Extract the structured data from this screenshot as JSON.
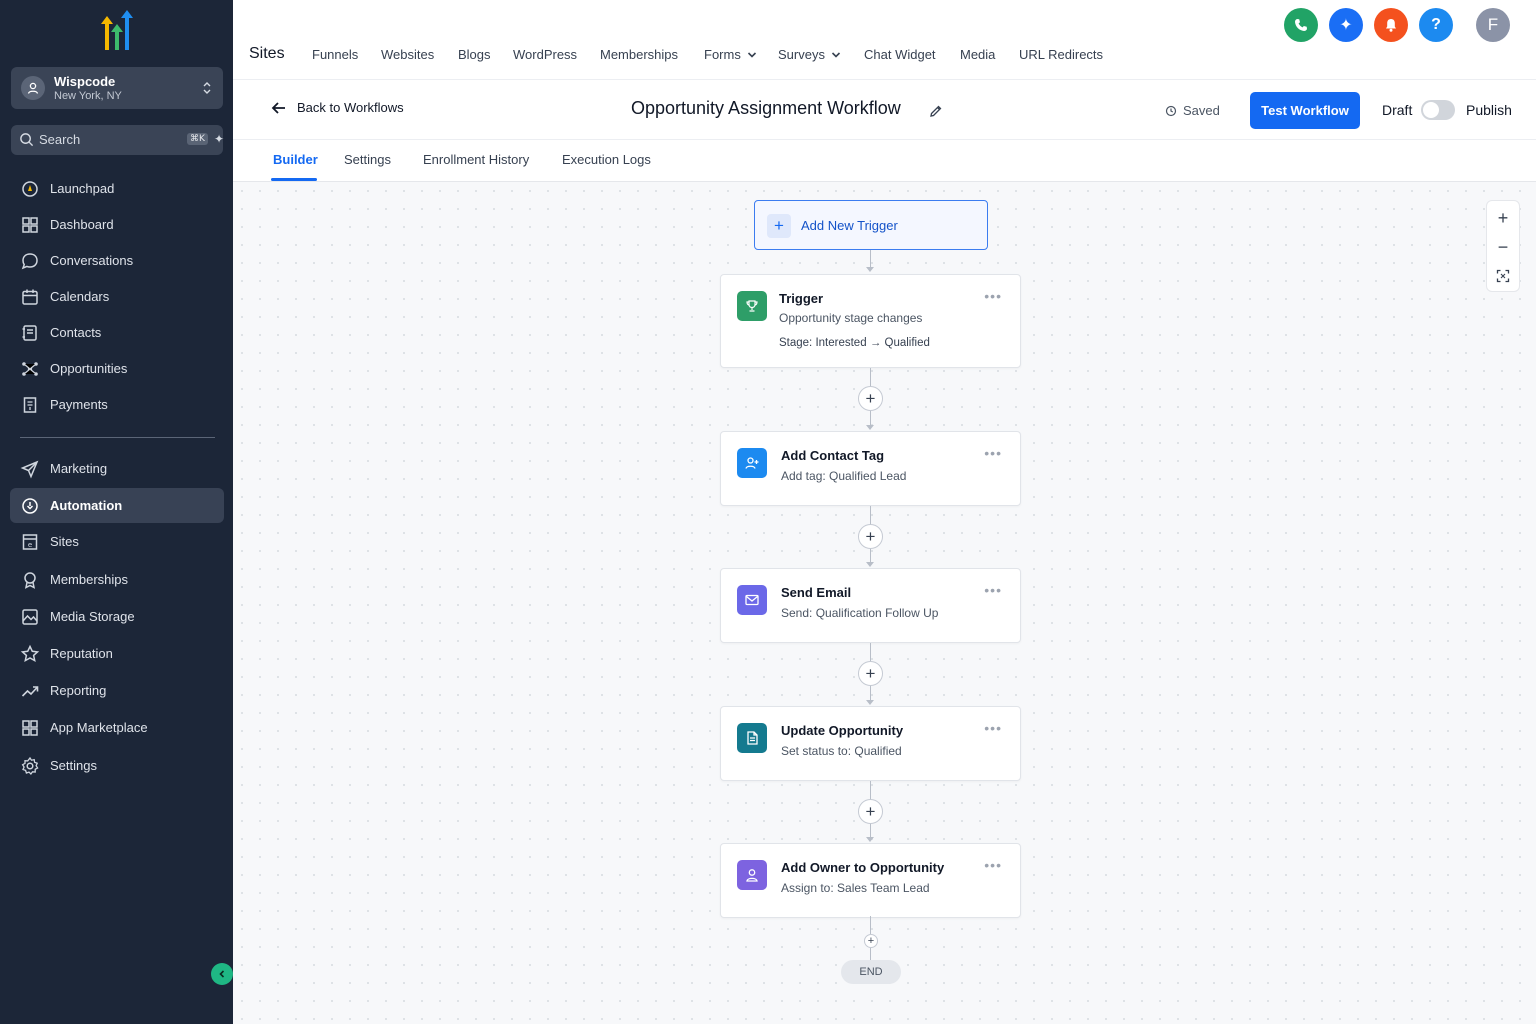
{
  "sidebar": {
    "account": {
      "name": "Wispcode",
      "location": "New York, NY"
    },
    "search": {
      "placeholder": "Search",
      "shortcut": "⌘K"
    },
    "items": [
      {
        "label": "Launchpad",
        "icon": "launchpad-icon"
      },
      {
        "label": "Dashboard",
        "icon": "dashboard-icon"
      },
      {
        "label": "Conversations",
        "icon": "chat-icon"
      },
      {
        "label": "Calendars",
        "icon": "calendar-icon"
      },
      {
        "label": "Contacts",
        "icon": "contacts-icon"
      },
      {
        "label": "Opportunities",
        "icon": "opportunities-icon"
      },
      {
        "label": "Payments",
        "icon": "payments-icon"
      },
      {
        "label": "Marketing",
        "icon": "send-icon"
      },
      {
        "label": "Automation",
        "icon": "automation-icon",
        "active": true
      },
      {
        "label": "Sites",
        "icon": "sites-icon"
      },
      {
        "label": "Memberships",
        "icon": "award-icon"
      },
      {
        "label": "Media Storage",
        "icon": "image-icon"
      },
      {
        "label": "Reputation",
        "icon": "star-icon"
      },
      {
        "label": "Reporting",
        "icon": "trend-icon"
      },
      {
        "label": "App Marketplace",
        "icon": "grid-icon"
      },
      {
        "label": "Settings",
        "icon": "gear-icon"
      }
    ]
  },
  "topbar": {
    "title": "Sites",
    "links": [
      "Funnels",
      "Websites",
      "Blogs",
      "WordPress",
      "Memberships",
      "Forms",
      "Surveys",
      "Chat Widget",
      "Media",
      "URL Redirects"
    ],
    "avatar_letter": "F",
    "colors": {
      "phone": "#21a366",
      "ai": "#1a6ef5",
      "bell": "#f4511e",
      "help": "#1c8af0",
      "avatar": "#8b93a7"
    }
  },
  "workflow": {
    "back_label": "Back to Workflows",
    "title": "Opportunity Assignment Workflow",
    "saved_label": "Saved",
    "test_label": "Test Workflow",
    "draft_label": "Draft",
    "publish_label": "Publish"
  },
  "tabs": [
    "Builder",
    "Settings",
    "Enrollment History",
    "Execution Logs"
  ],
  "canvas": {
    "add_trigger_label": "Add New Trigger",
    "trigger": {
      "title": "Trigger",
      "subtitle": "Opportunity stage changes",
      "meta_prefix": "Stage:",
      "meta_from": "Interested",
      "meta_arrow": "→",
      "meta_to": "Qualified"
    },
    "steps": [
      {
        "title": "Add Contact Tag",
        "subtitle": "Add tag: Qualified Lead",
        "color": "#1c8af0"
      },
      {
        "title": "Send Email",
        "subtitle": "Send: Qualification Follow Up",
        "color": "#6b68e8"
      },
      {
        "title": "Update Opportunity",
        "subtitle": "Set status to: Qualified",
        "color": "#147a8f"
      },
      {
        "title": "Add Owner to Opportunity",
        "subtitle": "Assign to: Sales Team Lead",
        "color": "#7d63e0"
      }
    ],
    "end_label": "END"
  }
}
